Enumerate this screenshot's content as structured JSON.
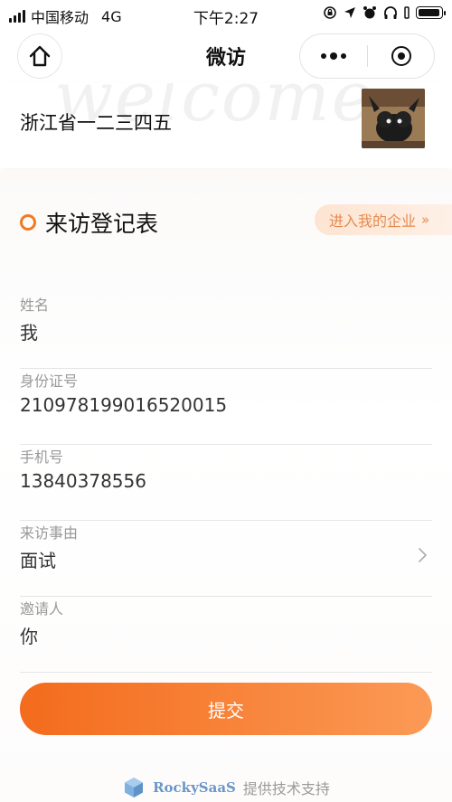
{
  "status": {
    "carrier": "中国移动",
    "network": "4G",
    "time": "下午2:27"
  },
  "nav": {
    "title": "微访"
  },
  "company": {
    "watermark": "welcome",
    "name": "浙江省一二三四五"
  },
  "form": {
    "title": "来访登记表",
    "enter_label": "进入我的企业",
    "fields": [
      {
        "label": "姓名",
        "value": "我"
      },
      {
        "label": "身份证号",
        "value": "210978199016520015"
      },
      {
        "label": "手机号",
        "value": "13840378556"
      },
      {
        "label": "来访事由",
        "value": "面试"
      },
      {
        "label": "邀请人",
        "value": "你"
      }
    ],
    "submit_label": "提交"
  },
  "footer": {
    "brand": "RockySaaS",
    "text": "提供技术支持"
  },
  "colors": {
    "accent": "#f46b1c",
    "brand": "#6a96c9"
  }
}
